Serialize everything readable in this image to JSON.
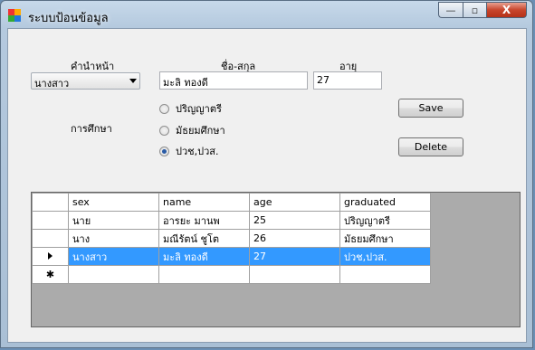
{
  "window": {
    "title": "ระบบป้อนข้อมูล",
    "min_glyph": "—",
    "max_glyph": "▫",
    "close_glyph": "X"
  },
  "form": {
    "prefix_label": "คำนำหน้า",
    "prefix_value": "นางสาว",
    "name_label": "ชื่อ-สกุล",
    "name_value": "มะลิ ทองดี",
    "age_label": "อายุ",
    "age_value": "27",
    "education_label": "การศึกษา",
    "education_options": [
      {
        "label": "ปริญญาตรี",
        "checked": false
      },
      {
        "label": "มัธยมศึกษา",
        "checked": false
      },
      {
        "label": "ปวช,ปวส.",
        "checked": true
      }
    ],
    "save_label": "Save",
    "delete_label": "Delete"
  },
  "grid": {
    "columns": [
      "sex",
      "name",
      "age",
      "graduated"
    ],
    "rows": [
      {
        "sex": "นาย",
        "name": "อารยะ มานพ",
        "age": "25",
        "graduated": "ปริญญาตรี"
      },
      {
        "sex": "นาง",
        "name": "มณีรัตน์ ชูโต",
        "age": "26",
        "graduated": "มัธยมศึกษา"
      },
      {
        "sex": "นางสาว",
        "name": "มะลิ ทองดี",
        "age": "27",
        "graduated": "ปวช,ปวส."
      }
    ],
    "new_row_marker": "✱",
    "selected_row": 2
  },
  "colors": {
    "selection": "#3399ff",
    "grid_background": "#ababab",
    "client_background": "#f0f0f0"
  }
}
